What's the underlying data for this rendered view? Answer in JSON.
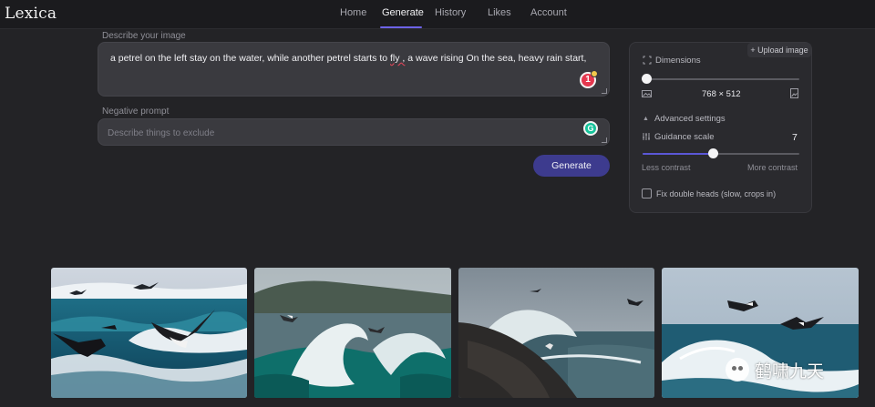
{
  "app": {
    "logo": "Lexica"
  },
  "nav": {
    "items": [
      {
        "label": "Home"
      },
      {
        "label": "Generate"
      },
      {
        "label": "History"
      },
      {
        "label": "Likes"
      },
      {
        "label": "Account"
      }
    ],
    "active_index": 1
  },
  "prompt": {
    "label": "Describe your image",
    "before_typo": "a petrel on the left stay on the water, while  another petrel starts to ",
    "typo_word": "fly ,",
    "after_typo": " a wave rising On the sea, heavy rain start,",
    "grammarly_count": "1"
  },
  "negative": {
    "label": "Negative prompt",
    "placeholder": "Describe things to exclude",
    "value": "",
    "grammarly_badge": "G"
  },
  "generate_button": "Generate",
  "settings": {
    "upload_label": "+ Upload image",
    "dimensions_label": "Dimensions",
    "dimensions_value": "768 × 512",
    "dimensions_slider_fraction": 0.0,
    "advanced_label": "Advanced settings",
    "guidance_label": "Guidance scale",
    "guidance_value": "7",
    "guidance_slider_fraction": 0.45,
    "less_contrast": "Less contrast",
    "more_contrast": "More contrast",
    "fix_heads_label": "Fix double heads (slow, crops in)",
    "fix_heads_checked": false
  },
  "results": [
    {
      "alt": "two petrels on rough sea waves"
    },
    {
      "alt": "cresting turquoise wave with birds"
    },
    {
      "alt": "wave breaking on dark rock with gulls"
    },
    {
      "alt": "petrels flying over breaking surf"
    }
  ],
  "watermark": {
    "text": "鹤啸九天"
  },
  "colors": {
    "accent": "#6d63e6",
    "button": "#3d3b8e",
    "background": "#232326",
    "grammarly_red": "#e5384f",
    "grammarly_green": "#15c39a"
  }
}
